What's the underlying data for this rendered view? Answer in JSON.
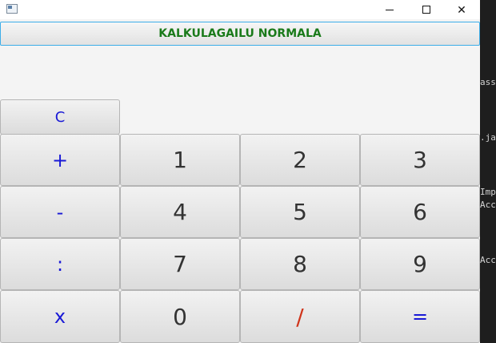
{
  "window": {
    "controls": {
      "minimize_icon": "minimize-icon",
      "maximize_icon": "maximize-icon",
      "close_glyph": "✕"
    }
  },
  "mode_button": {
    "label": "KALKULAGAILU NORMALA"
  },
  "keypad": {
    "clear": "C",
    "rows": [
      [
        "+",
        "1",
        "2",
        "3"
      ],
      [
        "-",
        "4",
        "5",
        "6"
      ],
      [
        ":",
        "7",
        "8",
        "9"
      ],
      [
        "x",
        "0",
        "/",
        "="
      ]
    ]
  },
  "background_editor": {
    "fragments": [
      "ass",
      ".ja",
      "Imp",
      "Acc",
      "Acc"
    ]
  },
  "colors": {
    "mode_text": "#1a7a1a",
    "operator_text": "#1a1ad6",
    "digit_text": "#333333",
    "divide_text": "#d0341a",
    "focus_border": "#3daee9"
  }
}
